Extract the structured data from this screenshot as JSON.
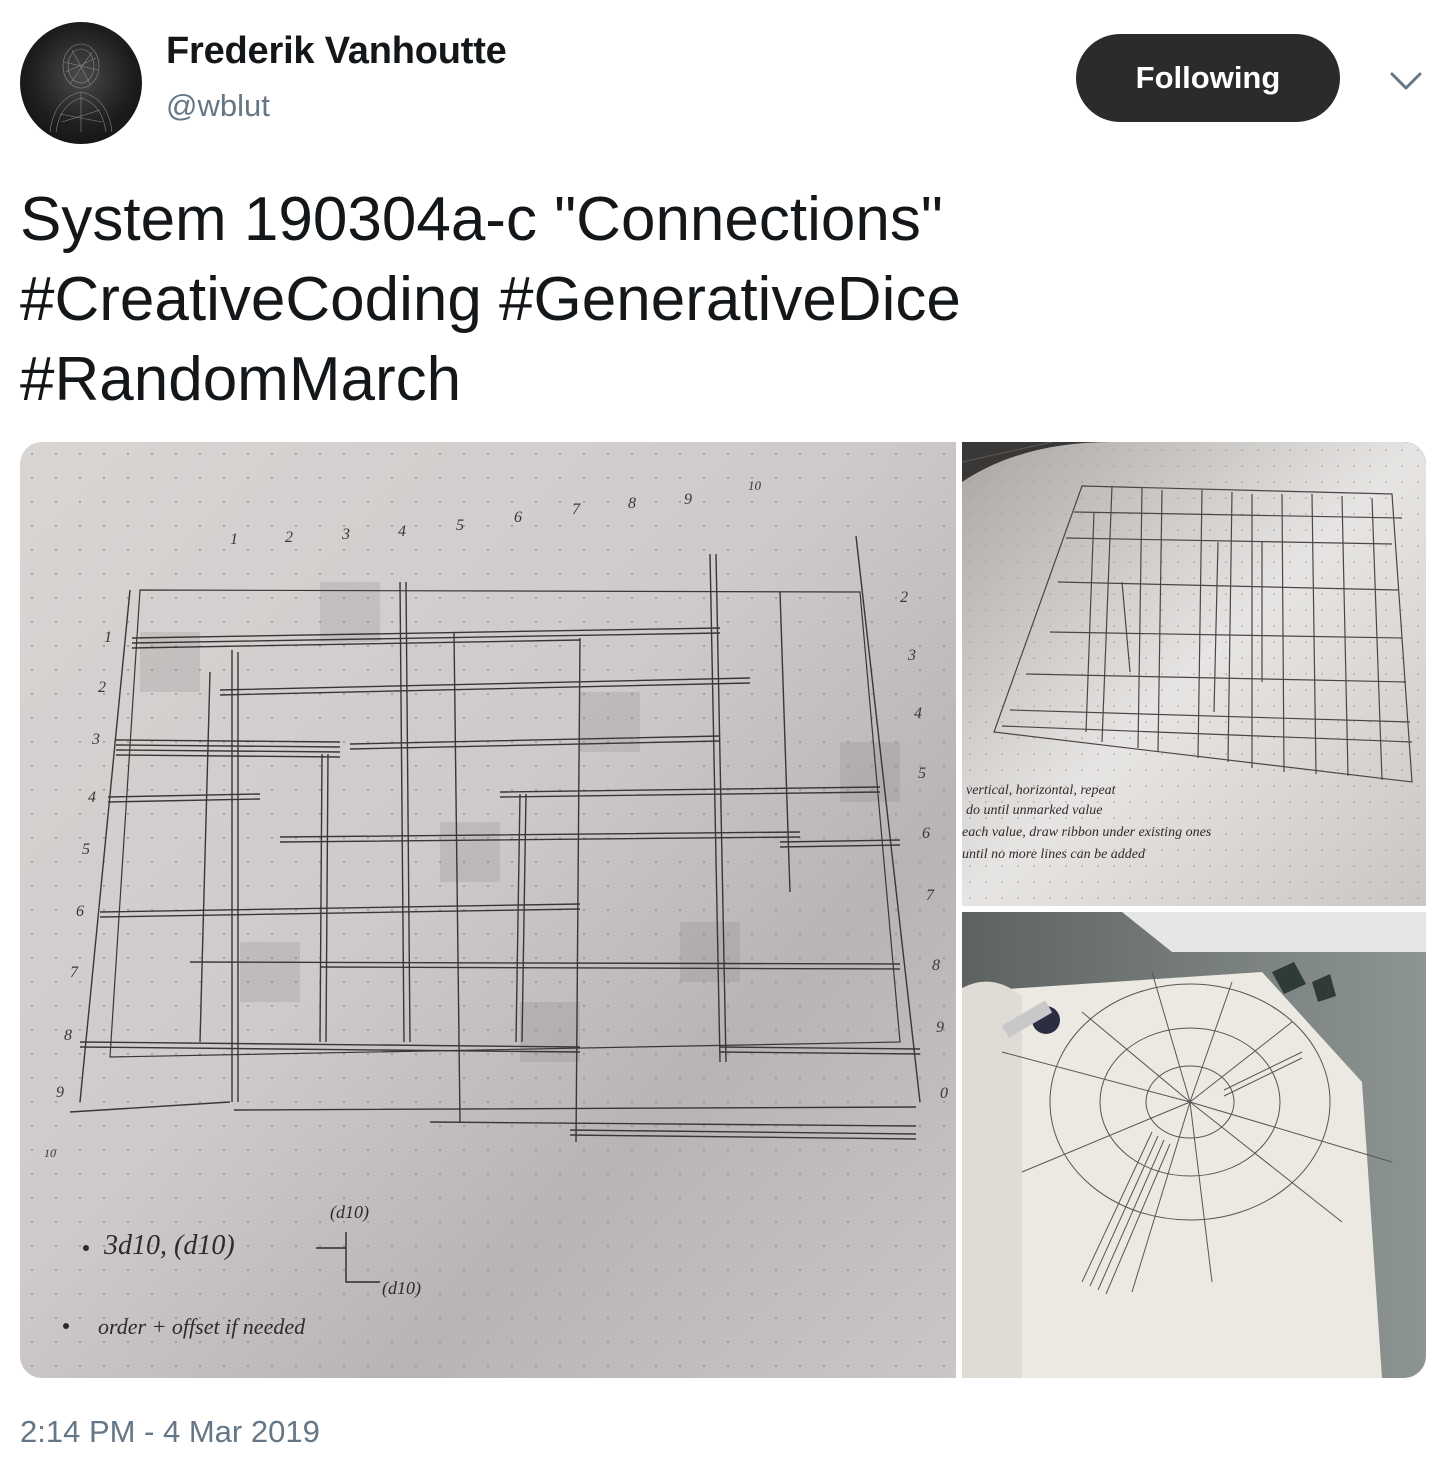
{
  "author": {
    "display_name": "Frederik Vanhoutte",
    "handle": "@wblut",
    "avatar_icon": "portrait-avatar-icon"
  },
  "actions": {
    "follow_label": "Following",
    "more_icon": "chevron-down-icon"
  },
  "tweet": {
    "text": "System 190304a-c \"Connections\"\n#CreativeCoding #GenerativeDice\n#RandomMarch",
    "timestamp": "2:14 PM - 4 Mar 2019"
  },
  "media": {
    "photos": [
      {
        "description_icon": "sketch-grid-connections-photo",
        "column_numbers": [
          "1",
          "2",
          "3",
          "4",
          "5",
          "6",
          "7",
          "8",
          "9",
          "10"
        ],
        "row_numbers": [
          "1",
          "2",
          "3",
          "4",
          "5",
          "6",
          "7",
          "8",
          "9",
          "10"
        ],
        "right_numbers": [
          "2",
          "3",
          "4",
          "5",
          "6",
          "7",
          "8",
          "9",
          "0"
        ],
        "note_line_1": "3d10,  (d10)",
        "note_line_1_tags": [
          "(d10)",
          "(d10)"
        ],
        "note_line_2": "order + offset if needed"
      },
      {
        "description_icon": "notebook-rectangles-photo",
        "notes": [
          "vertical, horizontal, repeat",
          "do until unmarked value",
          "each value, draw ribbon under existing ones",
          "until no more lines can be added"
        ]
      },
      {
        "description_icon": "radial-sketch-with-dice-photo"
      }
    ]
  },
  "colors": {
    "follow_button_bg": "#2b2b2b",
    "secondary_text": "#657786",
    "primary_text": "#14171a"
  }
}
